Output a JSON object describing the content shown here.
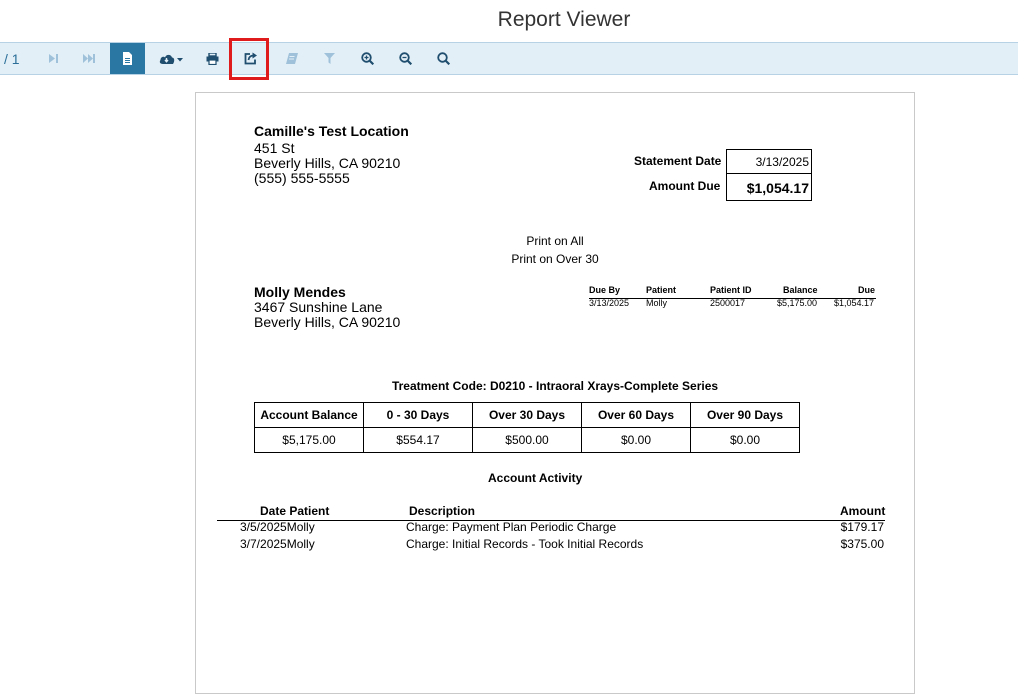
{
  "window": {
    "title": "Report Viewer"
  },
  "toolbar": {
    "page_total": "/ 1",
    "buttons": [
      {
        "name": "next-page",
        "icon": "next-page-icon"
      },
      {
        "name": "last-page",
        "icon": "last-page-icon"
      },
      {
        "name": "document-view",
        "icon": "document-icon"
      },
      {
        "name": "download",
        "icon": "cloud-download-icon"
      },
      {
        "name": "print",
        "icon": "print-icon"
      },
      {
        "name": "export",
        "icon": "export-icon"
      },
      {
        "name": "parameters",
        "icon": "book-icon"
      },
      {
        "name": "filter",
        "icon": "filter-icon"
      },
      {
        "name": "zoom-in",
        "icon": "zoom-in-icon"
      },
      {
        "name": "zoom-out",
        "icon": "zoom-out-icon"
      },
      {
        "name": "search",
        "icon": "search-icon"
      }
    ],
    "accent_color": "#2a77a3",
    "highlight_color": "#e01b1b"
  },
  "statement": {
    "practice": {
      "name": "Camille's Test Location",
      "street": "451 St",
      "city_line": "Beverly Hills, CA 90210",
      "phone": "(555) 555-5555"
    },
    "statement_date_label": "Statement Date",
    "statement_date": "3/13/2025",
    "amount_due_label": "Amount Due",
    "amount_due": "$1,054.17",
    "print_on_all": "Print on All",
    "print_on_over_30": "Print on Over 30",
    "patient": {
      "name": "Molly Mendes",
      "street": "3467 Sunshine Lane",
      "city_line": "Beverly Hills, CA 90210"
    },
    "due_table": {
      "headers": [
        "Due By",
        "Patient",
        "Patient ID",
        "Balance",
        "Due"
      ],
      "row": [
        "3/13/2025",
        "Molly",
        "2500017",
        "$5,175.00",
        "$1,054.17"
      ]
    },
    "treatment_code": "Treatment Code: D0210 - Intraoral Xrays-Complete Series",
    "aging": {
      "headers": [
        "Account Balance",
        "0 - 30 Days",
        "Over 30 Days",
        "Over 60 Days",
        "Over 90 Days"
      ],
      "values": [
        "$5,175.00",
        "$554.17",
        "$500.00",
        "$0.00",
        "$0.00"
      ]
    },
    "activity": {
      "title": "Account Activity",
      "headers": {
        "date_patient": "Date Patient",
        "description": "Description",
        "amount": "Amount"
      },
      "rows": [
        {
          "date": "3/5/2025",
          "patient": "Molly",
          "description": "Charge: Payment Plan Periodic Charge",
          "amount": "$179.17"
        },
        {
          "date": "3/7/2025",
          "patient": "Molly",
          "description": "Charge: Initial Records - Took Initial Records",
          "amount": "$375.00"
        }
      ]
    }
  }
}
